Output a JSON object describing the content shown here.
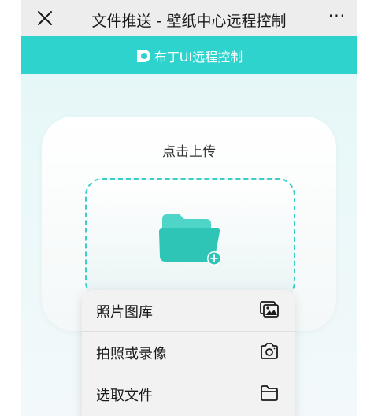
{
  "topbar": {
    "close_icon": "close-icon",
    "title": "文件推送 - 壁纸中心远程控制",
    "more_label": "···"
  },
  "brand": {
    "name": "布丁UI远程控制",
    "color": "#2fd3cd",
    "logo_icon": "brand-logo-icon"
  },
  "upload": {
    "title": "点击上传",
    "icon": "folder-add-icon"
  },
  "sheet": {
    "items": [
      {
        "label": "照片图库",
        "icon": "photo-library-icon"
      },
      {
        "label": "拍照或录像",
        "icon": "camera-icon"
      },
      {
        "label": "选取文件",
        "icon": "folder-icon"
      }
    ]
  }
}
